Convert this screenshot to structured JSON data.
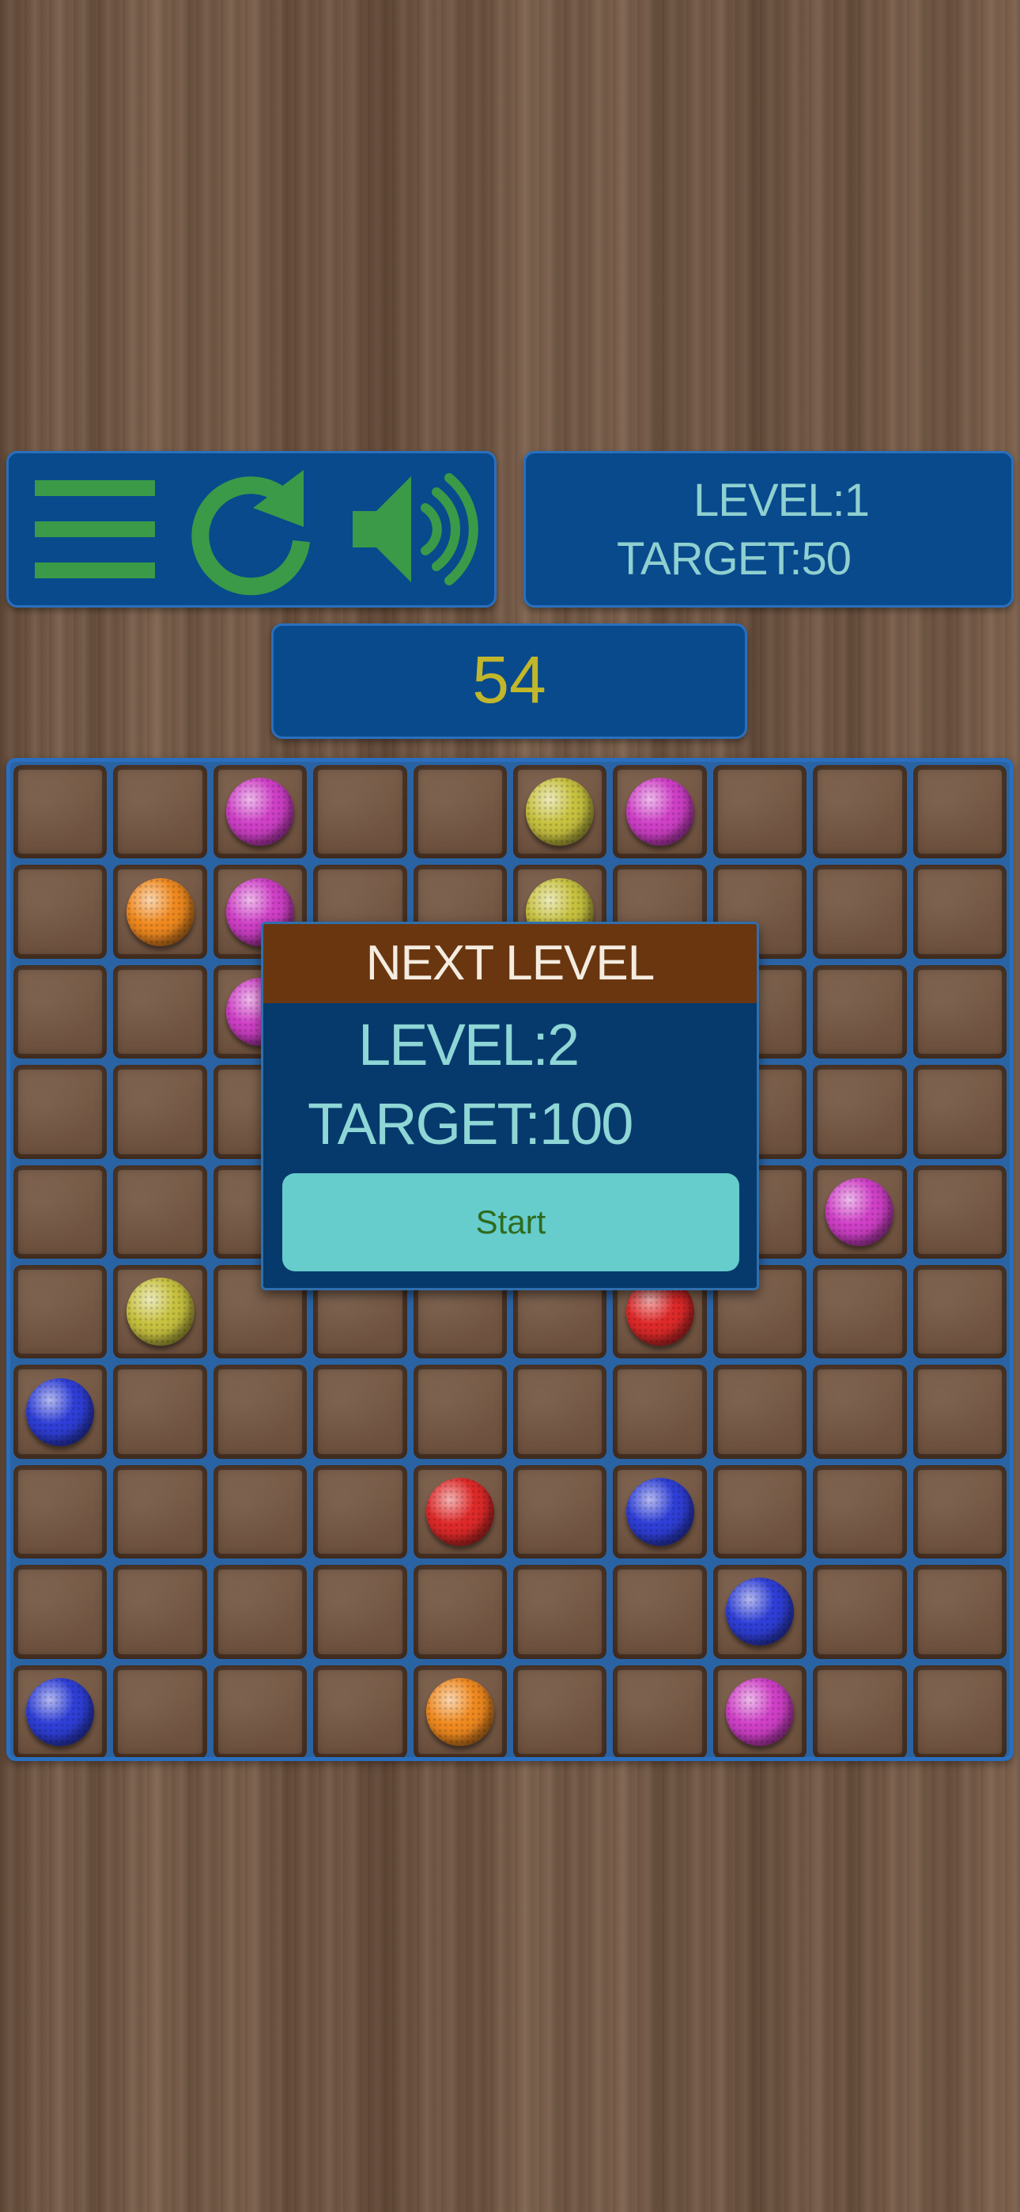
{
  "icons": {
    "menu": "hamburger-menu-icon",
    "restart": "restart-arrow-icon",
    "sound": "speaker-sound-icon"
  },
  "colors": {
    "panel": "#084a8c",
    "panel_border": "#2a6fbf",
    "icon_green": "#3a9a48",
    "level_text": "#8fd0d0",
    "score_text": "#c2b62a",
    "dialog_header": "#6a3610",
    "dialog_body": "#063a6c",
    "start_button": "#66cccc",
    "start_text": "#2f6a1d"
  },
  "hud": {
    "level": "LEVEL:1",
    "target": "TARGET:50",
    "score": "54"
  },
  "board": {
    "cols": 10,
    "rows": 10,
    "balls": [
      {
        "row": 0,
        "col": 2,
        "color": "magenta"
      },
      {
        "row": 0,
        "col": 5,
        "color": "yellow"
      },
      {
        "row": 0,
        "col": 6,
        "color": "magenta"
      },
      {
        "row": 1,
        "col": 1,
        "color": "orange"
      },
      {
        "row": 1,
        "col": 2,
        "color": "magenta"
      },
      {
        "row": 1,
        "col": 5,
        "color": "yellow"
      },
      {
        "row": 2,
        "col": 2,
        "color": "magenta"
      },
      {
        "row": 4,
        "col": 8,
        "color": "magenta"
      },
      {
        "row": 5,
        "col": 1,
        "color": "yellow"
      },
      {
        "row": 5,
        "col": 6,
        "color": "red"
      },
      {
        "row": 6,
        "col": 0,
        "color": "blue"
      },
      {
        "row": 7,
        "col": 4,
        "color": "red"
      },
      {
        "row": 7,
        "col": 6,
        "color": "blue"
      },
      {
        "row": 8,
        "col": 7,
        "color": "blue"
      },
      {
        "row": 9,
        "col": 0,
        "color": "blue"
      },
      {
        "row": 9,
        "col": 4,
        "color": "orange"
      },
      {
        "row": 9,
        "col": 7,
        "color": "magenta"
      }
    ]
  },
  "ball_colors": {
    "magenta": "#d040c8",
    "yellow": "#c8c240",
    "orange": "#f08a20",
    "red": "#e02a2a",
    "blue": "#2f3fd8"
  },
  "dialog": {
    "title": "NEXT LEVEL",
    "level": "LEVEL:2",
    "target": "TARGET:100",
    "start_label": "Start"
  }
}
